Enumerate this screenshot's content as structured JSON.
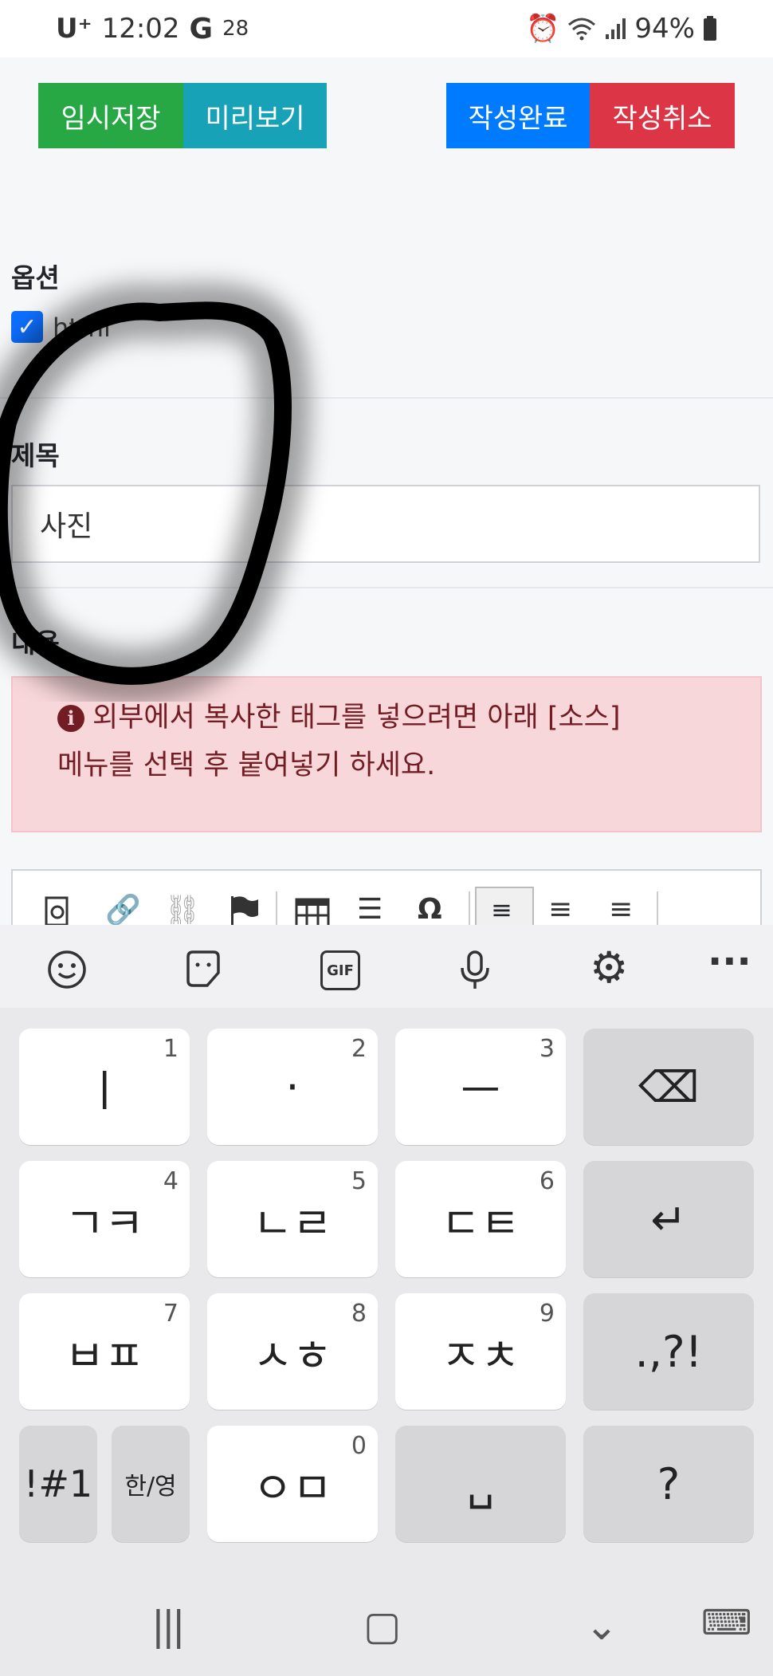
{
  "status_bar": {
    "carrier": "U⁺",
    "time": "12:02",
    "indicator": "28",
    "battery": "94%",
    "icons": [
      "alarm-icon",
      "wifi-icon",
      "signal-icon",
      "battery-icon"
    ]
  },
  "toolbar": {
    "save_label": "임시저장",
    "preview_label": "미리보기",
    "done_label": "작성완료",
    "cancel_label": "작성취소"
  },
  "options": {
    "label": "옵션",
    "checkbox_label": "html",
    "checked": true
  },
  "title": {
    "label": "제목",
    "value": "사진"
  },
  "content": {
    "label": "내용",
    "alert_line1": "외부에서 복사한 태그를 넣으려면 아래 [소스]",
    "alert_line2": "메뉴를 선택 후 붙여넣기 하세요."
  },
  "editor_toolbar_icons": [
    "find-icon",
    "link-icon",
    "unlink-icon",
    "anchor-icon",
    "table-icon",
    "horizontal-line-icon",
    "special-char-icon",
    "align-left-icon",
    "align-center-icon",
    "align-right-icon"
  ],
  "keyboard": {
    "toolbar_icons": [
      "emoji-icon",
      "sticker-icon",
      "gif-icon",
      "mic-icon",
      "settings-icon",
      "more-icon"
    ],
    "gif_label": "GIF",
    "rows": [
      [
        {
          "label": "ㅣ",
          "num": "1"
        },
        {
          "label": "·",
          "num": "2"
        },
        {
          "label": "ㅡ",
          "num": "3"
        },
        {
          "label": "⌫",
          "num": ""
        }
      ],
      [
        {
          "label": "ㄱㅋ",
          "num": "4"
        },
        {
          "label": "ㄴㄹ",
          "num": "5"
        },
        {
          "label": "ㄷㅌ",
          "num": "6"
        },
        {
          "label": "↵",
          "num": ""
        }
      ],
      [
        {
          "label": "ㅂㅍ",
          "num": "7"
        },
        {
          "label": "ㅅㅎ",
          "num": "8"
        },
        {
          "label": "ㅈㅊ",
          "num": "9"
        },
        {
          "label": ".,?!",
          "num": ""
        }
      ],
      [
        {
          "label": "!#1",
          "num": ""
        },
        {
          "label": "한/영",
          "num": ""
        },
        {
          "label": "ㅇㅁ",
          "num": "0"
        },
        {
          "label": "␣",
          "num": ""
        },
        {
          "label": "?",
          "num": ""
        }
      ]
    ]
  },
  "nav_bar": {
    "recent_label": "|||",
    "home_label": "▢",
    "back_label": "⌄",
    "keyboard_label": "⌨"
  }
}
